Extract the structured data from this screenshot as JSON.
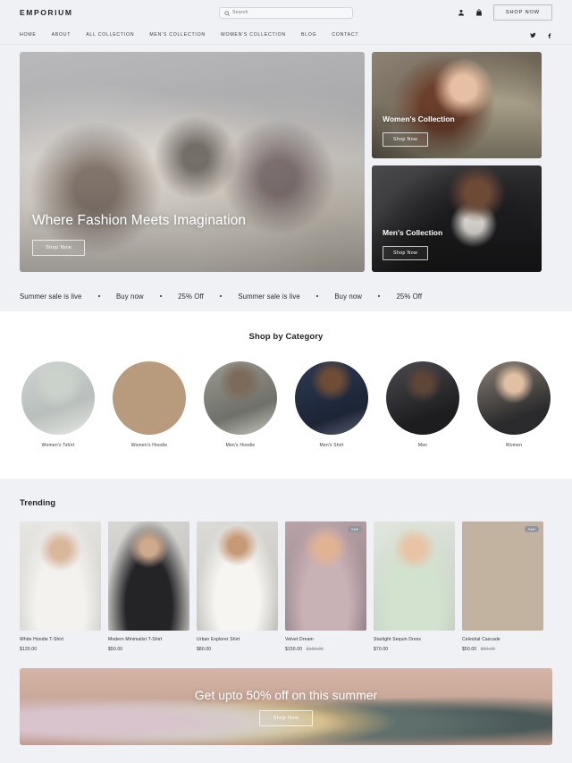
{
  "header": {
    "brand": "EMPORIUM",
    "search": {
      "placeholder": "Search",
      "value": "",
      "icon": "search-icon"
    },
    "account_icon": "user-icon",
    "cart_icon": "bag-icon",
    "shop_now_label": "SHOP NOW",
    "nav": [
      {
        "label": "HOME"
      },
      {
        "label": "ABOUT"
      },
      {
        "label": "ALL COLLECTION"
      },
      {
        "label": "MEN'S COLLECTION"
      },
      {
        "label": "WOMEN'S COLLECTION"
      },
      {
        "label": "BLOG"
      },
      {
        "label": "CONTACT"
      }
    ],
    "social": [
      {
        "name": "twitter-icon"
      },
      {
        "name": "facebook-icon"
      }
    ]
  },
  "hero": {
    "main": {
      "title": "Where Fashion Meets Imagination",
      "button_label": "Shop Now"
    },
    "cards": [
      {
        "title": "Women's Collection",
        "button_label": "Shop Now"
      },
      {
        "title": "Men's Collection",
        "button_label": "Shop Now"
      }
    ]
  },
  "marquee": {
    "items": [
      "Summer sale is live",
      "Buy now",
      "25% Off",
      "Summer sale is live",
      "Buy now",
      "25% Off"
    ]
  },
  "categories": {
    "title": "Shop by Category",
    "items": [
      {
        "label": "Women's Tshirt"
      },
      {
        "label": "Women's Hoodie"
      },
      {
        "label": "Men's Hoodie"
      },
      {
        "label": "Men's Shirt"
      },
      {
        "label": "Men"
      },
      {
        "label": "Women"
      }
    ]
  },
  "trending": {
    "title": "Trending",
    "products": [
      {
        "name": "White Hoodie T-Shirt",
        "price": "$120.00",
        "old_price": "",
        "badge": ""
      },
      {
        "name": "Modern Minimalist T-Shirt",
        "price": "$50.00",
        "old_price": "",
        "badge": ""
      },
      {
        "name": "Urban Explorer Shirt",
        "price": "$80.00",
        "old_price": "",
        "badge": ""
      },
      {
        "name": "Velvet Dream",
        "price": "$150.00",
        "old_price": "$160.00",
        "badge": "Sale"
      },
      {
        "name": "Starlight Sequin Dress",
        "price": "$70.00",
        "old_price": "",
        "badge": ""
      },
      {
        "name": "Celestial Cascade",
        "price": "$50.00",
        "old_price": "$60.00",
        "badge": "Sale"
      }
    ]
  },
  "promo": {
    "title": "Get upto 50% off on this summer",
    "button_label": "Shop Now"
  },
  "colors": {
    "page_bg": "#eff1f4",
    "card_bg": "#ffffff",
    "text": "#22242a",
    "muted": "#9aa0a8",
    "badge": "#8f949d"
  }
}
